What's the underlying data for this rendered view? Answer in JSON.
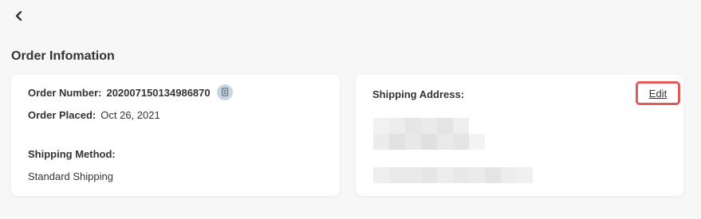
{
  "header": {
    "back_icon": "chevron-left-icon",
    "title": "Order Infomation"
  },
  "order": {
    "number_label": "Order Number:",
    "number_value": "202007150134986870",
    "copy_icon": "copy-icon",
    "placed_label": "Order Placed:",
    "placed_value": "Oct 26, 2021",
    "shipping_method_label": "Shipping Method:",
    "shipping_method_value": "Standard Shipping"
  },
  "shipping": {
    "address_label": "Shipping Address:",
    "edit_label": "Edit",
    "highlight_color": "#e05a5a"
  }
}
